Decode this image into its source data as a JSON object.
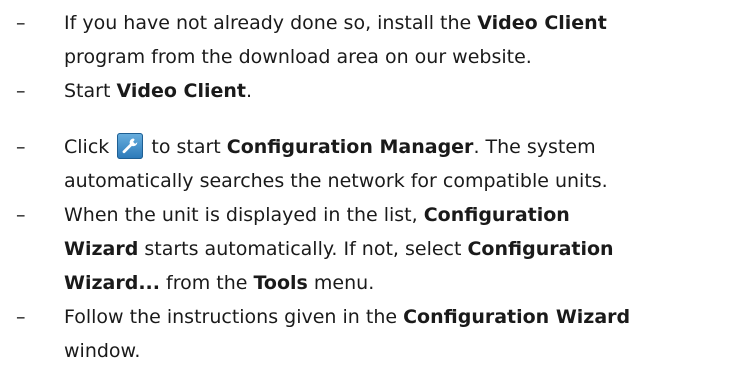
{
  "dash": "–",
  "steps": [
    {
      "lines": [
        [
          {
            "t": "If you have not already done so, install the "
          },
          {
            "t": "Video Client",
            "b": true
          }
        ],
        [
          {
            "t": "program from the download area on our website."
          }
        ]
      ]
    },
    {
      "lines": [
        [
          {
            "t": "Start "
          },
          {
            "t": "Video Client",
            "b": true
          },
          {
            "t": "."
          }
        ]
      ]
    },
    {
      "lines": [
        [
          {
            "t": "Click "
          },
          {
            "icon": "wrench-icon"
          },
          {
            "t": " to start "
          },
          {
            "t": "Configuration Manager",
            "b": true
          },
          {
            "t": ". The system"
          }
        ],
        [
          {
            "t": "automatically searches the network for compatible units."
          }
        ]
      ]
    },
    {
      "lines": [
        [
          {
            "t": "When the unit is displayed in the list, "
          },
          {
            "t": "Configuration",
            "b": true
          }
        ],
        [
          {
            "t": "Wizard",
            "b": true
          },
          {
            "t": " starts automatically. If not, select "
          },
          {
            "t": "Configuration",
            "b": true
          }
        ],
        [
          {
            "t": "Wizard...",
            "b": true
          },
          {
            "t": " from the "
          },
          {
            "t": "Tools",
            "b": true
          },
          {
            "t": " menu."
          }
        ]
      ]
    },
    {
      "lines": [
        [
          {
            "t": "Follow the instructions given in the "
          },
          {
            "t": "Configuration Wizard",
            "b": true
          }
        ],
        [
          {
            "t": "window."
          }
        ]
      ]
    }
  ]
}
